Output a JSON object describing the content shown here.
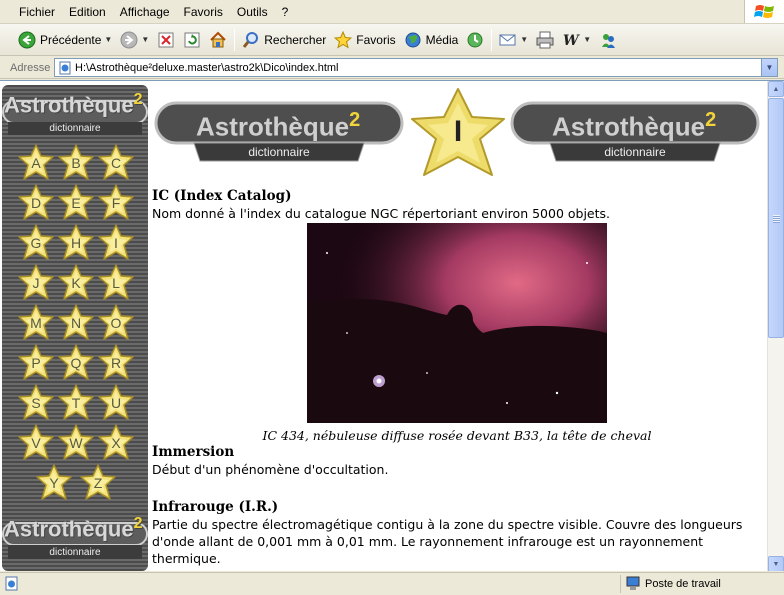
{
  "menu": [
    "Fichier",
    "Edition",
    "Affichage",
    "Favoris",
    "Outils",
    "?"
  ],
  "toolbar": {
    "back_label": "Précédente",
    "search_label": "Rechercher",
    "favorites_label": "Favoris",
    "media_label": "Média"
  },
  "address": {
    "label": "Adresse",
    "url": "H:\\Astrothèque²deluxe.master\\astro2k\\Dico\\index.html"
  },
  "logo": {
    "name": "Astrothèque",
    "sup": "2",
    "subtitle": "dictionnaire"
  },
  "current_letter": "I",
  "letters": [
    "A",
    "B",
    "C",
    "D",
    "E",
    "F",
    "G",
    "H",
    "I",
    "J",
    "K",
    "L",
    "M",
    "N",
    "O",
    "P",
    "Q",
    "R",
    "S",
    "T",
    "U",
    "V",
    "W",
    "X",
    "Y",
    "Z"
  ],
  "entries": [
    {
      "term": "IC (Index Catalog)",
      "definition": "Nom donné à l'index du catalogue NGC répertoriant environ 5000 objets."
    },
    {
      "term": "Immersion",
      "definition": "Début d'un phénomène d'occultation."
    },
    {
      "term": "Infrarouge (I.R.)",
      "definition": "Partie du spectre électromagétique contigu à la zone du spectre visible. Couvre des longueurs d'onde allant de 0,001 mm à 0,01 mm. Le rayonnement infrarouge est un rayonnement thermique."
    }
  ],
  "photo_caption": "IC 434, nébuleuse diffuse rosée devant B33, la tête de cheval",
  "status": {
    "zone": "Poste de travail"
  },
  "colors": {
    "star_fill": "#f3e27a",
    "nav_bg": "#555555",
    "xp_blue": "#7f9db9"
  }
}
